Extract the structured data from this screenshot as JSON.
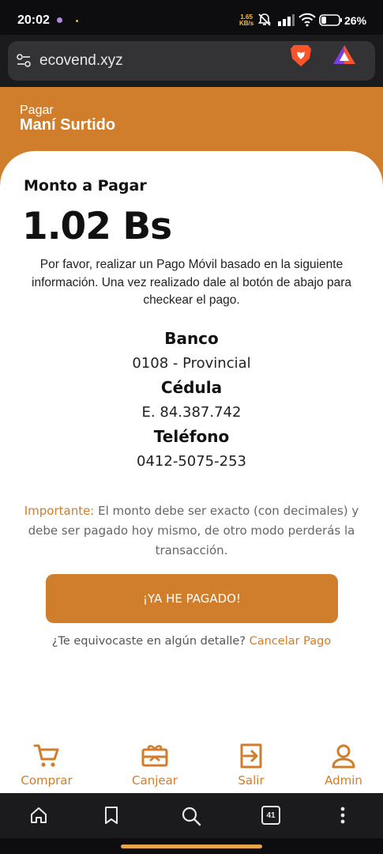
{
  "status_bar": {
    "time": "20:02",
    "net_speed_value": "1.65",
    "net_speed_unit": "KB/s",
    "battery": "26%"
  },
  "browser": {
    "url": "ecovend.xyz",
    "tab_count": "41"
  },
  "header": {
    "subtitle": "Pagar",
    "title": "Maní Surtido"
  },
  "payment": {
    "amount_label": "Monto a Pagar",
    "amount_value": "1.02 Bs",
    "instructions": "Por favor, realizar un Pago Móvil basado en la siguiente información. Una vez realizado dale al botón de abajo para checkear el pago.",
    "bank_label": "Banco",
    "bank_value": "0108 - Provincial",
    "id_label": "Cédula",
    "id_value": "E. 84.387.742",
    "phone_label": "Teléfono",
    "phone_value": "0412-5075-253",
    "important_keyword": "Importante:",
    "important_text": " El monto debe ser exacto (con decimales) y debe ser pagado hoy mismo, de otro modo perderás la transacción.",
    "paid_button": "¡YA HE PAGADO!",
    "cancel_prompt": "¿Te equivocaste en algún detalle? ",
    "cancel_link": "Cancelar Pago"
  },
  "bottom_nav": [
    {
      "label": "Comprar",
      "icon": "cart-icon"
    },
    {
      "label": "Canjear",
      "icon": "gift-card-icon"
    },
    {
      "label": "Salir",
      "icon": "exit-icon"
    },
    {
      "label": "Admin",
      "icon": "user-icon"
    }
  ],
  "colors": {
    "accent": "#d07d2c",
    "browser_bg": "#1b1b1d",
    "url_pill": "#333336"
  }
}
